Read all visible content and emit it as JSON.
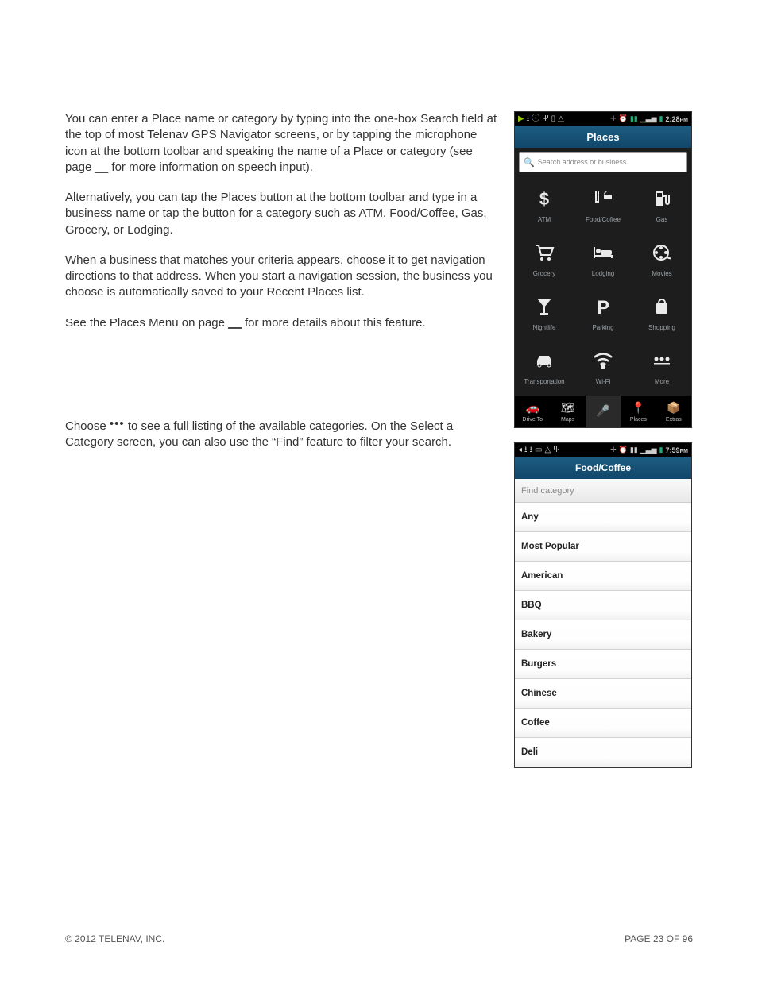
{
  "body": {
    "p1": "You can enter a Place name or category by typing into the one-box Search field at the top of most Telenav GPS Navigator screens, or by tapping the microphone icon at the bottom toolbar and speaking the name of a Place or category (see page ",
    "p1_end": " for more information on speech input).",
    "p2": "Alternatively, you can tap the Places button at the bottom toolbar and type in a business name or tap the button for a category such as ATM, Food/Coffee, Gas, Grocery, or Lodging.",
    "p3": "When a business that matches your criteria appears, choose it to get navigation directions to that address. When you start a navigation session, the business you choose is automatically saved to your Recent Places list.",
    "p4_a": "See the Places Menu on page ",
    "p4_b": " for more details about this feature.",
    "choose_a": "Choose ",
    "choose_b": " to see a full listing of the available categories. On the Select a Category screen, you can also use the “Find” feature to filter your search.",
    "blank": "__"
  },
  "footer": {
    "left": "© 2012 TELENAV, INC.",
    "right": "PAGE 23 OF 96"
  },
  "phone1": {
    "time": "2:28",
    "ampm": "PM",
    "title": "Places",
    "search_placeholder": "Search address or business",
    "grid": [
      {
        "label": "ATM"
      },
      {
        "label": "Food/Coffee"
      },
      {
        "label": "Gas"
      },
      {
        "label": "Grocery"
      },
      {
        "label": "Lodging"
      },
      {
        "label": "Movies"
      },
      {
        "label": "Nightlife"
      },
      {
        "label": "Parking"
      },
      {
        "label": "Shopping"
      },
      {
        "label": "Transportation"
      },
      {
        "label": "Wi-Fi"
      },
      {
        "label": "More"
      }
    ],
    "bottom": [
      {
        "label": "Drive To"
      },
      {
        "label": "Maps"
      },
      {
        "label": ""
      },
      {
        "label": "Places"
      },
      {
        "label": "Extras"
      }
    ]
  },
  "phone2": {
    "time": "7:59",
    "ampm": "PM",
    "title": "Food/Coffee",
    "find_placeholder": "Find category",
    "categories": [
      "Any",
      "Most Popular",
      "American",
      "BBQ",
      "Bakery",
      "Burgers",
      "Chinese",
      "Coffee",
      "Deli"
    ]
  }
}
